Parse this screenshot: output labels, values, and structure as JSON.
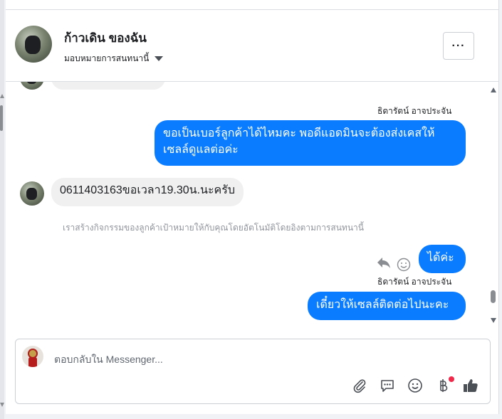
{
  "header": {
    "title": "ก้าวเดิน ของฉัน",
    "assign_label": "มอบหมายการสนทนานี้",
    "more_label": "···"
  },
  "messages": [
    {
      "direction": "outgoing",
      "sender": "ธิดารัตน์ อาจประจัน",
      "text": "ขอเป็นเบอร์ลูกค้าได้ไหมคะ พอดีแอดมินจะต้องส่งเคสให้เซลล์ดูแลต่อค่ะ"
    },
    {
      "direction": "incoming",
      "text": "0611403163ขอเวลา19.30น.นะครับ"
    },
    {
      "type": "system",
      "text": "เราสร้างกิจกรรมของลูกค้าเป้าหมายให้กับคุณโดยอัตโนมัติโดยอิงตามการสนทนานี้"
    },
    {
      "direction": "outgoing",
      "text": "ได้ค่ะ"
    },
    {
      "direction": "outgoing",
      "sender": "ธิดารัตน์ อาจประจัน",
      "text": "เดี๋ยวให้เซลล์ติดต่อไปนะคะ"
    }
  ],
  "composer": {
    "placeholder": "ตอบกลับใน Messenger...",
    "tools": [
      "paperclip-icon",
      "saved-reply-icon",
      "emoji-icon",
      "baht-payment-icon",
      "thumbs-up-icon"
    ]
  },
  "colors": {
    "outgoing_bubble": "#0a7cff",
    "incoming_bubble": "#f0f0f0",
    "notification_dot": "#f02849"
  }
}
